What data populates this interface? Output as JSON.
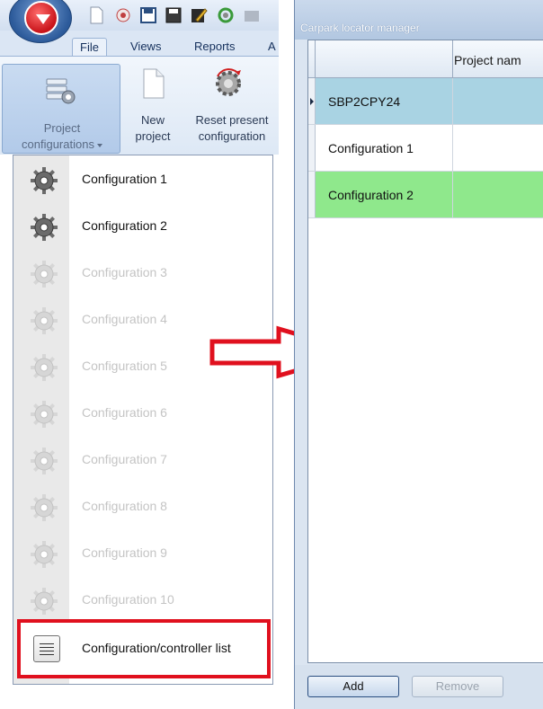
{
  "ribbon": {
    "tabs": [
      "File",
      "Views",
      "Reports",
      "A"
    ],
    "buttons": {
      "project_configurations": [
        "Project",
        "configurations"
      ],
      "new_project": [
        "New",
        "project"
      ],
      "reset_present_configuration": [
        "Reset present",
        "configuration"
      ]
    }
  },
  "dropdown": {
    "items": [
      {
        "label": "Configuration 1",
        "enabled": true
      },
      {
        "label": "Configuration 2",
        "enabled": true
      },
      {
        "label": "Configuration 3",
        "enabled": false
      },
      {
        "label": "Configuration 4",
        "enabled": false
      },
      {
        "label": "Configuration 5",
        "enabled": false
      },
      {
        "label": "Configuration 6",
        "enabled": false
      },
      {
        "label": "Configuration 7",
        "enabled": false
      },
      {
        "label": "Configuration 8",
        "enabled": false
      },
      {
        "label": "Configuration 9",
        "enabled": false
      },
      {
        "label": "Configuration 10",
        "enabled": false
      }
    ],
    "list_item_label": "Configuration/controller list"
  },
  "window": {
    "title": "Carpark locator manager",
    "grid": {
      "header_col2": "Project nam",
      "rows": [
        {
          "col1": "SBP2CPY24",
          "color": "#a9d3e3"
        },
        {
          "col1": "Configuration 1",
          "color": "#ffffff"
        },
        {
          "col1": "Configuration 2",
          "color": "#8fe88c"
        }
      ]
    },
    "buttons": {
      "add": "Add",
      "remove": "Remove"
    }
  },
  "colors": {
    "highlight_border": "#e0101e",
    "arrow": "#e0101e",
    "row_selected": "#a9d3e3",
    "row_active": "#8fe88c"
  },
  "icons": {
    "menu_item": "gear-icon",
    "list_item": "list-icon",
    "annotation": "arrow-right-icon"
  }
}
